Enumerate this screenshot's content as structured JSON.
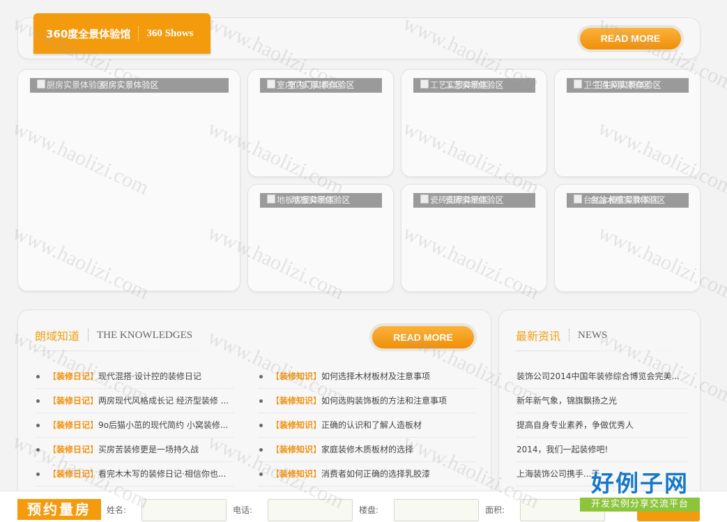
{
  "watermark": "www.haolizi.com",
  "colors": {
    "accent": "#f39a0d",
    "caption_bg": "#9a9a9a",
    "logo_blue": "#1878c8",
    "logo_green": "#8cc43c"
  },
  "showcase": {
    "title_cn": "360度全景体验馆",
    "title_en": "360 Shows",
    "read_more": "READ MORE",
    "tiles": [
      {
        "alt": "厨房实景体验区",
        "caption": "厨房实景体验区"
      },
      {
        "alt": "室内门实景体验区",
        "caption": "室内门实景体验区"
      },
      {
        "alt": "工艺实景体验区",
        "caption": "工艺实景体验区"
      },
      {
        "alt": "卫生间实景体验区",
        "caption": "卫生间实景体验区"
      },
      {
        "alt": "地板实景体验区",
        "caption": "地板实景体验区"
      },
      {
        "alt": "瓷砖实景体验区",
        "caption": "瓷砖实景体验区"
      },
      {
        "alt": "台盆水槽实景体验区",
        "caption": "台盆水槽实景体验区"
      }
    ]
  },
  "knowledge": {
    "title_cn": "朗域知道",
    "title_en": "THE KNOWLEDGES",
    "read_more": "READ MORE",
    "left": [
      {
        "tag": "装修日记",
        "text": "现代混搭·设计控的装修日记"
      },
      {
        "tag": "装修日记",
        "text": "两房现代风格成长记 经济型装修 ..."
      },
      {
        "tag": "装修日记",
        "text": "9o后猫小茁的现代简约 小窝装修..."
      },
      {
        "tag": "装修日记",
        "text": "买房苦装修更是一场持久战"
      },
      {
        "tag": "装修日记",
        "text": "看完木木写的装修日记·相信你也..."
      }
    ],
    "right": [
      {
        "tag": "装修知识",
        "text": "如何选择木材板材及注意事项"
      },
      {
        "tag": "装修知识",
        "text": "如何选购装饰板的方法和注意事项"
      },
      {
        "tag": "装修知识",
        "text": "正确的认识和了解人造板材"
      },
      {
        "tag": "装修知识",
        "text": "家庭装修木质板材的选择"
      },
      {
        "tag": "装修知识",
        "text": "消费者如何正确的选择乳胶漆"
      }
    ]
  },
  "news": {
    "title_cn": "最新资讯",
    "title_en": "NEWS",
    "items": [
      "装饰公司2014中国年装修综合博览会完美...",
      "新年新气象，锦旗飘扬之光",
      "提高自身专业素养，争做优秀人",
      "2014，我们一起装修吧!",
      "上海装饰公司携手...天"
    ]
  },
  "booking": {
    "title": "预约量房",
    "fields": [
      "姓名:",
      "电话:",
      "楼盘:",
      "面积:"
    ]
  },
  "logo": {
    "main": "好例子网",
    "sub": "开发实例分享交流平台"
  }
}
